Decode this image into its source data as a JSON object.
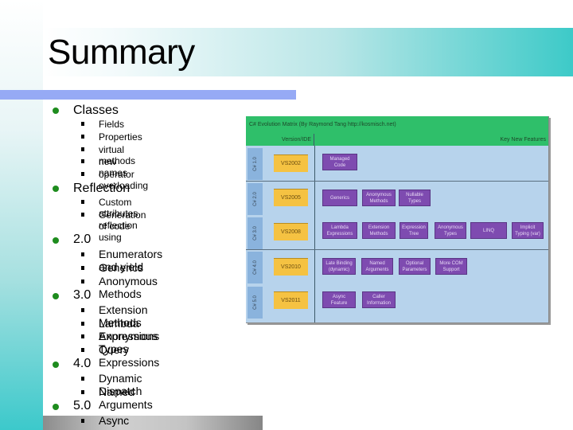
{
  "slide": {
    "title": "Summary",
    "outline": [
      {
        "label": "Classes",
        "items": [
          "Fields",
          "Properties",
          "virtual methods",
          "new names",
          "operator overloading"
        ]
      },
      {
        "label": "Reflection",
        "items": [
          "Custom attributes",
          "Generation of code using",
          "reflection"
        ]
      },
      {
        "label": "2.0",
        "items": [
          "Enumerators and yield",
          "Generics",
          "Anonymous Methods"
        ]
      },
      {
        "label": "3.0",
        "items": [
          "Extension Methods",
          "Lambda Expressions",
          "Anonymous Types",
          "Query Expressions"
        ]
      },
      {
        "label": "4.0",
        "items": [
          "Dynamic Dispatch",
          "Named Arguments"
        ]
      },
      {
        "label": "5.0",
        "items": [
          "Async"
        ]
      }
    ]
  },
  "matrix": {
    "title": "C# Evolution Matrix (By Raymond Tang http://kosmisch.net)",
    "col_version": "Version/IDE",
    "col_features": "Key New Features",
    "rows": [
      {
        "version": "C# 1.0",
        "ide": "VS2002",
        "features": [
          "Managed Code"
        ]
      },
      {
        "version": "C# 2.0",
        "ide": "VS2005",
        "features": [
          "Generics",
          "Anonymous Methods",
          "Nullable Types"
        ]
      },
      {
        "version": "C# 3.0",
        "ide": "VS2008",
        "features": [
          "Lambda Expressions",
          "Extension Methods",
          "Expression Tree",
          "Anonymous Types",
          "LINQ",
          "Implicit Typing (var)"
        ]
      },
      {
        "version": "C# 4.0",
        "ide": "VS2010",
        "features": [
          "Late Binding (dynamic)",
          "Named Arguments",
          "Optional Parameters",
          "More COM Support"
        ]
      },
      {
        "version": "C# 5.0",
        "ide": "VS2011",
        "features": [
          "Async Feature",
          "Caller Information"
        ]
      }
    ],
    "colors": {
      "header": "#2fbf6a",
      "body": "#b7d3ec",
      "ide": "#f5c242",
      "feature": "#7e4bb0",
      "version_tab": "#8ab3dd"
    }
  }
}
